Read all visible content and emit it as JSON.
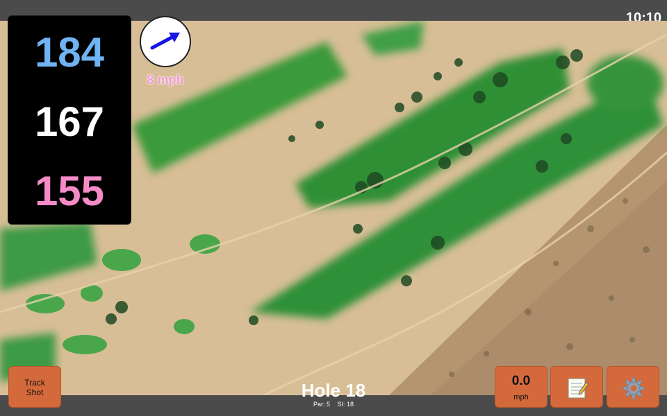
{
  "status": {
    "time": "10:10"
  },
  "yardages": {
    "back": "184",
    "middle": "167",
    "front": "155"
  },
  "colors": {
    "back": "#6fb3f2",
    "middle": "#ffffff",
    "front": "#f58bc6",
    "wind_text": "#f19ad2",
    "button": "#d46a3c",
    "arrow": "#1515e6"
  },
  "wind": {
    "speed": "8 mph",
    "direction_icon": "arrow-right-icon"
  },
  "buttons": {
    "track_shot": [
      "Track",
      "Shot"
    ],
    "speed_value": "0.0",
    "speed_unit": "mph",
    "notes_icon": "notepad-icon",
    "settings_icon": "gear-icon"
  },
  "hole": {
    "title": "Hole 18",
    "par": "Par: 5",
    "si": "SI: 18"
  }
}
